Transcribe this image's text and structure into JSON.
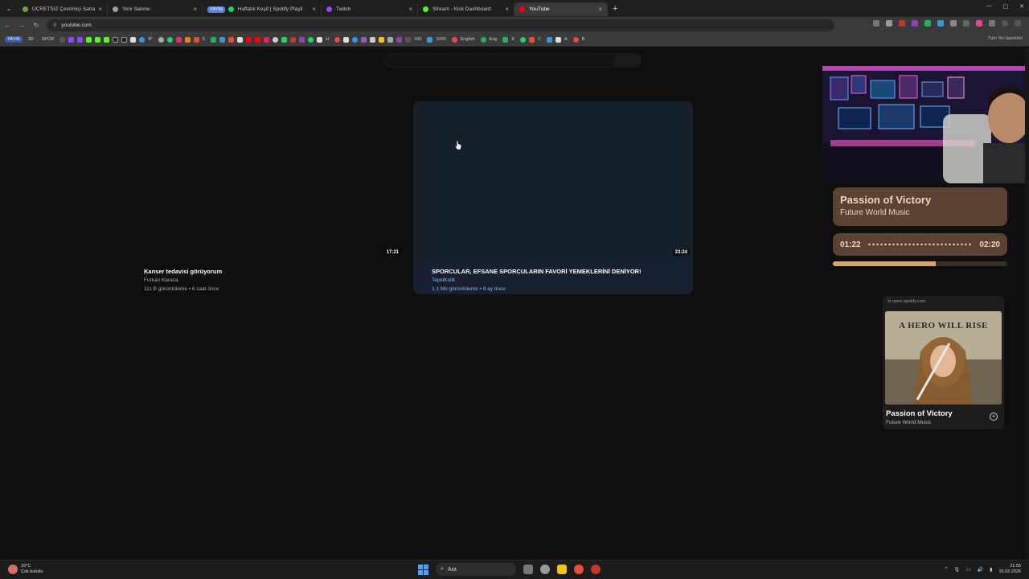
{
  "browser": {
    "tabs": [
      {
        "title": "ÜCRETSİZ Çevrimiçi Satranç Oy",
        "favicon_color": "#7a9a3c",
        "active": false
      },
      {
        "title": "Yeni Sekme",
        "favicon_color": "#9aa0a6",
        "active": false
      },
      {
        "badge": "YAYIN",
        "title": "Haftalık Keşif | Spotify Playli",
        "favicon_color": "#1ed760",
        "active": false
      },
      {
        "title": "Twitch",
        "favicon_color": "#9146ff",
        "active": false
      },
      {
        "title": "Stream - Kick Dashboard",
        "favicon_color": "#53fc18",
        "active": false
      },
      {
        "title": "YouTube",
        "favicon_color": "#ff0000",
        "active": true
      }
    ],
    "url": "youtube.com",
    "bookmarks_prefix": [
      "YAYIN",
      "3D",
      "SPOR"
    ],
    "bookmark_labels": [
      "IP",
      "S",
      "H",
      "100",
      "1000",
      "English",
      "Eng",
      "K",
      "C",
      "A",
      "B"
    ],
    "all_bookmarks_label": "Tüm Yer İşaretleri"
  },
  "videos": [
    {
      "title": "Kanser tedavisi görüyorum",
      "channel": "Furkan Karaca",
      "meta": "111 B görüntüleme • 6 saat önce",
      "duration": "17:21"
    },
    {
      "title": "SPORCULAR, EFSANE SPORCULARIN FAVORİ YEMEKLERİNİ DENİYOR!",
      "channel": "TepkiKolik",
      "meta": "1,1 Mn görüntüleme • 8 ay önce",
      "duration": "23:24"
    }
  ],
  "now_playing": {
    "title": "Passion of Victory",
    "artist": "Future World Music",
    "elapsed": "01:22",
    "total": "02:20",
    "progress": 0.59,
    "accent": "#5b4234"
  },
  "spotify_card": {
    "source": "open.spotify.com",
    "album_art_text": "A HERO WILL RISE",
    "title": "Passion of Victory",
    "artist": "Future World Music"
  },
  "taskbar": {
    "weather_temp": "16°C",
    "weather_desc": "Çok bulutlu",
    "search_label": "Ara",
    "time": "21:55",
    "date": "15.02.2026"
  }
}
